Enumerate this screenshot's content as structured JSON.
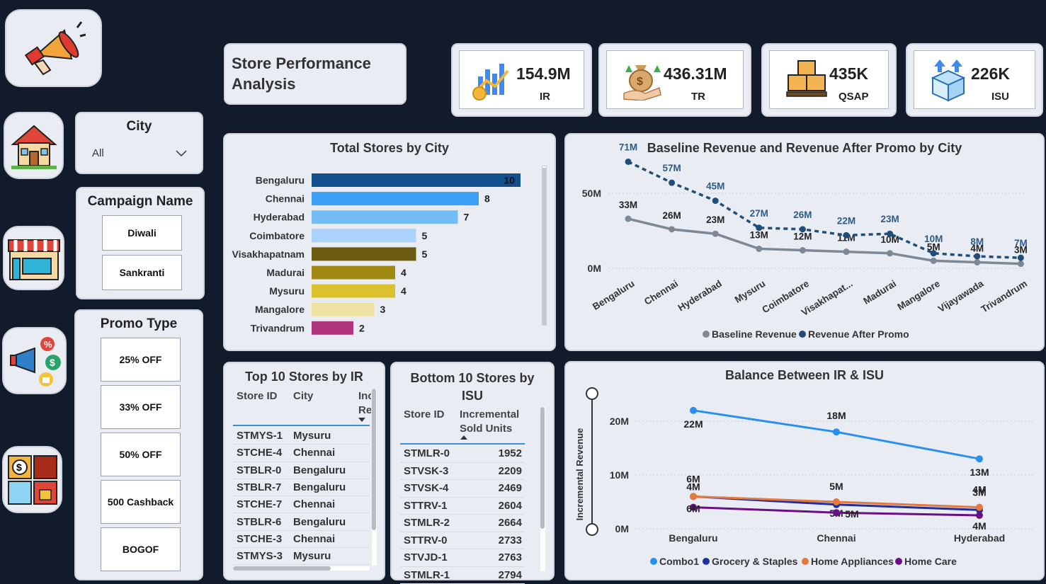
{
  "header": {
    "title_line1": "Store Performance",
    "title_line2": "Analysis"
  },
  "kpis": [
    {
      "value": "154.9M",
      "label": "IR",
      "icon": "chart-coin-icon"
    },
    {
      "value": "436.31M",
      "label": "TR",
      "icon": "money-bag-hand-icon"
    },
    {
      "value": "435K",
      "label": "QSAP",
      "icon": "stacked-boxes-icon"
    },
    {
      "value": "226K",
      "label": "ISU",
      "icon": "box-arrows-icon"
    }
  ],
  "nav_icons": [
    "megaphone-icon",
    "house-icon",
    "storefront-icon",
    "promo-megaphone-icon",
    "finance-grid-icon"
  ],
  "filters": {
    "city": {
      "title": "City",
      "selected": "All"
    },
    "campaign": {
      "title": "Campaign Name",
      "options": [
        "Diwali",
        "Sankranti"
      ]
    },
    "promo": {
      "title": "Promo Type",
      "options": [
        "25% OFF",
        "33% OFF",
        "50% OFF",
        "500 Cashback",
        "BOGOF"
      ]
    }
  },
  "top_stores": {
    "title": "Top 10 Stores by IR",
    "columns": [
      "Store ID",
      "City",
      "Inc",
      "Re"
    ],
    "rows": [
      [
        "STMYS-1",
        "Mysuru"
      ],
      [
        "STCHE-4",
        "Chennai"
      ],
      [
        "STBLR-0",
        "Bengaluru"
      ],
      [
        "STBLR-7",
        "Bengaluru"
      ],
      [
        "STCHE-7",
        "Chennai"
      ],
      [
        "STBLR-6",
        "Bengaluru"
      ],
      [
        "STCHE-3",
        "Chennai"
      ],
      [
        "STMYS-3",
        "Mysuru"
      ]
    ]
  },
  "bottom_stores": {
    "title_line1": "Bottom 10 Stores by",
    "title_line2": "ISU",
    "columns": [
      "Store ID",
      "Incremental",
      "Sold Units"
    ],
    "rows": [
      [
        "STMLR-0",
        "1952"
      ],
      [
        "STVSK-3",
        "2209"
      ],
      [
        "STVSK-4",
        "2469"
      ],
      [
        "STTRV-1",
        "2604"
      ],
      [
        "STMLR-2",
        "2664"
      ],
      [
        "STTRV-0",
        "2733"
      ],
      [
        "STVJD-1",
        "2763"
      ],
      [
        "STMLR-1",
        "2794"
      ]
    ]
  },
  "chart_data": [
    {
      "type": "bar",
      "title": "Total Stores by City",
      "categories": [
        "Bengaluru",
        "Chennai",
        "Hyderabad",
        "Coimbatore",
        "Visakhapatnam",
        "Madurai",
        "Mysuru",
        "Mangalore",
        "Trivandrum"
      ],
      "values": [
        10,
        8,
        7,
        5,
        5,
        4,
        4,
        3,
        2
      ],
      "colors": [
        "#124f8c",
        "#3aa0f5",
        "#72bdf7",
        "#a9d3fa",
        "#6b5a10",
        "#a08a12",
        "#dcc12e",
        "#efe3a2",
        "#b0357c"
      ],
      "xlim": [
        0,
        10
      ]
    },
    {
      "type": "line",
      "title": "Baseline Revenue and Revenue After Promo by City",
      "categories": [
        "Bengaluru",
        "Chennai",
        "Hyderabad",
        "Mysuru",
        "Coimbatore",
        "Visakhapat...",
        "Madurai",
        "Mangalore",
        "Vijayawada",
        "Trivandrum"
      ],
      "y_ticks": [
        "50M",
        "0M"
      ],
      "ylim": [
        0,
        80
      ],
      "series": [
        {
          "name": "Baseline Revenue",
          "color": "#7d8896",
          "values": [
            33,
            26,
            23,
            13,
            12,
            11,
            10,
            5,
            4,
            3
          ],
          "labels": [
            "33M",
            "26M",
            "23M",
            "13M",
            "12M",
            "11M",
            "10M",
            "5M",
            "4M",
            "3M"
          ]
        },
        {
          "name": "Revenue After Promo",
          "color": "#1f4e79",
          "values": [
            71,
            57,
            45,
            27,
            26,
            22,
            23,
            10,
            8,
            7
          ],
          "labels": [
            "71M",
            "57M",
            "45M",
            "27M",
            "26M",
            "22M",
            "23M",
            "10M",
            "8M",
            "7M"
          ]
        }
      ],
      "legend": "bottom"
    },
    {
      "type": "line",
      "title": "Balance Between IR & ISU",
      "ylabel": "Incremental Revenue",
      "categories": [
        "Bengaluru",
        "Chennai",
        "Hyderabad"
      ],
      "y_ticks": [
        "20M",
        "10M",
        "0M"
      ],
      "ylim": [
        0,
        25
      ],
      "series": [
        {
          "name": "Combo1",
          "color": "#2b8fef",
          "values": [
            22,
            18,
            13
          ],
          "labels": [
            "22M",
            "18M",
            "13M"
          ]
        },
        {
          "name": "Grocery & Staples",
          "color": "#1f2fa0",
          "values": [
            6,
            4.5,
            3.5
          ],
          "labels": [
            "6M",
            "5M",
            "3M"
          ]
        },
        {
          "name": "Home Appliances",
          "color": "#e5783c",
          "values": [
            6,
            5,
            4
          ],
          "labels": [
            "4M",
            "5M",
            "4M"
          ]
        },
        {
          "name": "Home Care",
          "color": "#6a0f86",
          "values": [
            4,
            3,
            2.5
          ],
          "labels": [
            "6M",
            "5M",
            "4M"
          ]
        }
      ],
      "legend": "bottom"
    }
  ]
}
